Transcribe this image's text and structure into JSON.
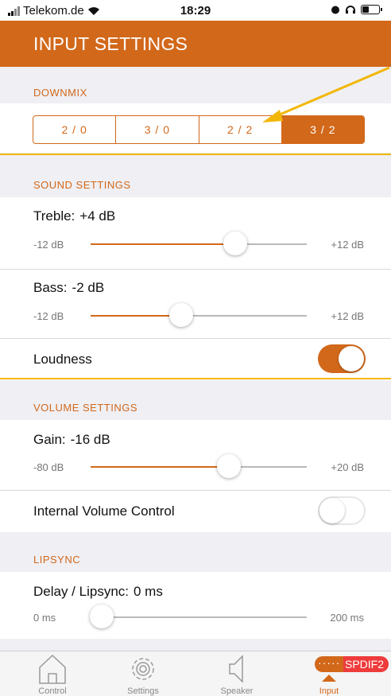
{
  "status_bar": {
    "carrier": "Telekom.de",
    "time": "18:29"
  },
  "header": {
    "title": "INPUT SETTINGS"
  },
  "downmix": {
    "label": "DOWNMIX",
    "options": [
      "2 / 0",
      "3 / 0",
      "2 / 2",
      "3 / 2"
    ],
    "selected_index": 3
  },
  "sound": {
    "label": "SOUND SETTINGS",
    "treble": {
      "label": "Treble:",
      "value": "+4 dB",
      "min": "-12 dB",
      "max": "+12 dB",
      "level": 0.67
    },
    "bass": {
      "label": "Bass:",
      "value": "-2 dB",
      "min": "-12 dB",
      "max": "+12 dB",
      "level": 0.42
    },
    "loudness": {
      "label": "Loudness",
      "on": true
    }
  },
  "volume": {
    "label": "VOLUME SETTINGS",
    "gain": {
      "label": "Gain:",
      "value": "-16 dB",
      "min": "-80 dB",
      "max": "+20 dB",
      "level": 0.64
    },
    "internal": {
      "label": "Internal Volume Control",
      "on": false
    }
  },
  "lipsync": {
    "label": "LIPSYNC",
    "delay": {
      "label": "Delay / Lipsync:",
      "value": "0 ms",
      "min": "0 ms",
      "max": "200 ms",
      "level": 0.0
    }
  },
  "tabs": [
    {
      "label": "Control",
      "icon": "home-icon"
    },
    {
      "label": "Settings",
      "icon": "gear-icon"
    },
    {
      "label": "Speaker",
      "icon": "speaker-icon"
    },
    {
      "label": "Input",
      "icon": "triangle-up-icon"
    }
  ],
  "input_badge": "SPDIF2",
  "colors": {
    "accent": "#d2681a",
    "highlight": "#f2b705",
    "badge": "#ee3b3b"
  }
}
